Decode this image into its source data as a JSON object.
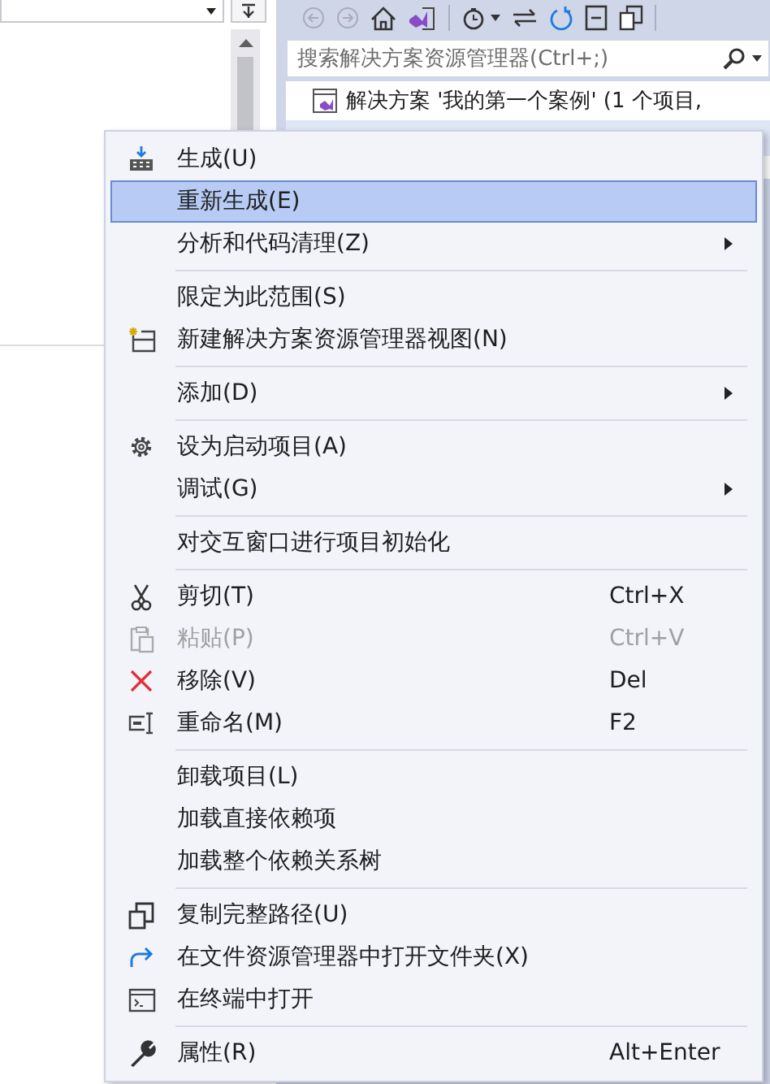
{
  "solution_explorer": {
    "search": {
      "placeholder": "搜索解决方案资源管理器(Ctrl+;)"
    },
    "tree": [
      {
        "label": "解决方案 '我的第一个案例' (1 个项目,"
      }
    ]
  },
  "context_menu": {
    "items": [
      {
        "kind": "item",
        "label": "生成(U)",
        "selected": false,
        "disabled": false,
        "submenu": false
      },
      {
        "kind": "item",
        "label": "重新生成(E)",
        "selected": true,
        "disabled": false,
        "submenu": false
      },
      {
        "kind": "item",
        "label": "分析和代码清理(Z)",
        "selected": false,
        "disabled": false,
        "submenu": true
      },
      {
        "kind": "separator"
      },
      {
        "kind": "item",
        "label": "限定为此范围(S)",
        "selected": false,
        "disabled": false,
        "submenu": false
      },
      {
        "kind": "item",
        "label": "新建解决方案资源管理器视图(N)",
        "selected": false,
        "disabled": false,
        "submenu": false
      },
      {
        "kind": "separator"
      },
      {
        "kind": "item",
        "label": "添加(D)",
        "selected": false,
        "disabled": false,
        "submenu": true
      },
      {
        "kind": "separator"
      },
      {
        "kind": "item",
        "label": "设为启动项目(A)",
        "selected": false,
        "disabled": false,
        "submenu": false
      },
      {
        "kind": "item",
        "label": "调试(G)",
        "selected": false,
        "disabled": false,
        "submenu": true
      },
      {
        "kind": "separator"
      },
      {
        "kind": "item",
        "label": "对交互窗口进行项目初始化",
        "selected": false,
        "disabled": false,
        "submenu": false
      },
      {
        "kind": "separator"
      },
      {
        "kind": "item",
        "label": "剪切(T)",
        "shortcut": "Ctrl+X",
        "selected": false,
        "disabled": false,
        "submenu": false
      },
      {
        "kind": "item",
        "label": "粘贴(P)",
        "shortcut": "Ctrl+V",
        "selected": false,
        "disabled": true,
        "submenu": false
      },
      {
        "kind": "item",
        "label": "移除(V)",
        "shortcut": "Del",
        "selected": false,
        "disabled": false,
        "submenu": false
      },
      {
        "kind": "item",
        "label": "重命名(M)",
        "shortcut": "F2",
        "selected": false,
        "disabled": false,
        "submenu": false
      },
      {
        "kind": "separator"
      },
      {
        "kind": "item",
        "label": "卸载项目(L)",
        "selected": false,
        "disabled": false,
        "submenu": false
      },
      {
        "kind": "item",
        "label": "加载直接依赖项",
        "selected": false,
        "disabled": false,
        "submenu": false
      },
      {
        "kind": "item",
        "label": "加载整个依赖关系树",
        "selected": false,
        "disabled": false,
        "submenu": false
      },
      {
        "kind": "separator"
      },
      {
        "kind": "item",
        "label": "复制完整路径(U)",
        "selected": false,
        "disabled": false,
        "submenu": false
      },
      {
        "kind": "item",
        "label": "在文件资源管理器中打开文件夹(X)",
        "selected": false,
        "disabled": false,
        "submenu": false
      },
      {
        "kind": "item",
        "label": "在终端中打开",
        "selected": false,
        "disabled": false,
        "submenu": false
      },
      {
        "kind": "separator"
      },
      {
        "kind": "item",
        "label": "属性(R)",
        "shortcut": "Alt+Enter",
        "selected": false,
        "disabled": false,
        "submenu": false
      }
    ]
  }
}
